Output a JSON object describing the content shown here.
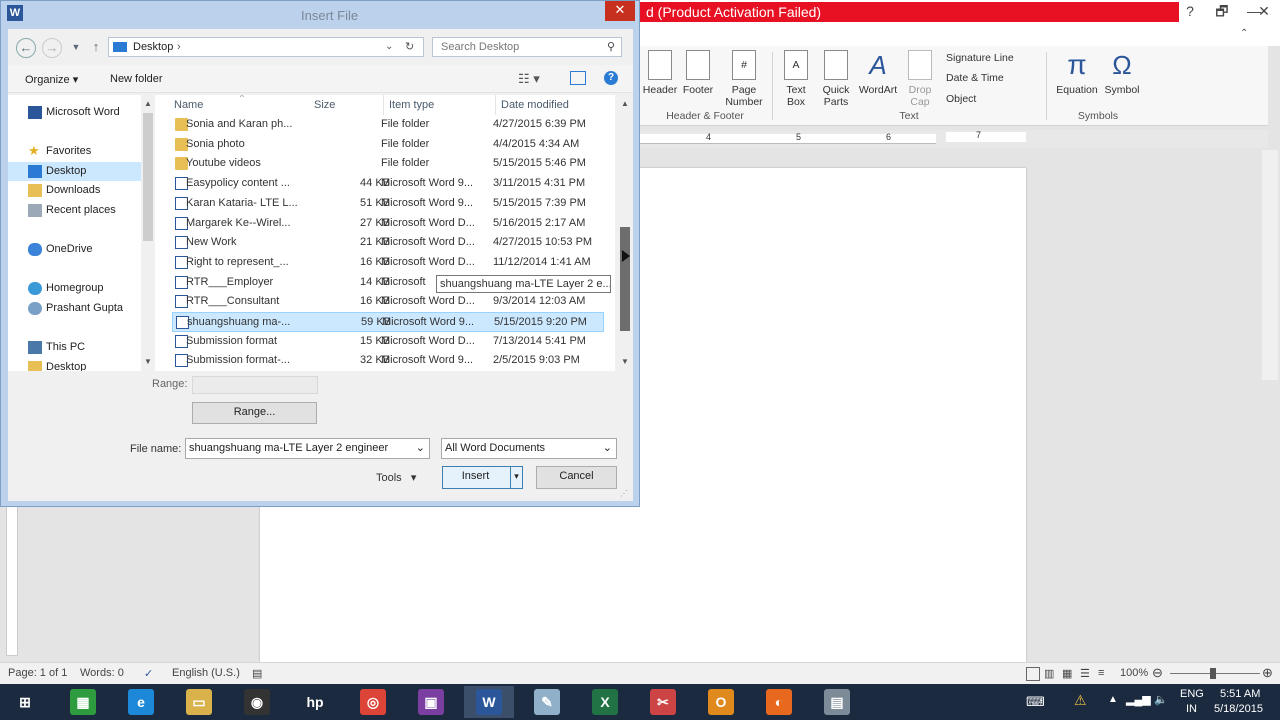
{
  "word": {
    "title_suffix": "d (Product Activation Failed)",
    "window_controls": [
      "?",
      "🗗",
      "—",
      "✕"
    ],
    "ribbon": {
      "buttons": [
        {
          "id": "header",
          "label": "Header"
        },
        {
          "id": "footer",
          "label": "Footer"
        },
        {
          "id": "page_number",
          "label": "Page Number"
        },
        {
          "id": "text_box",
          "label": "Text Box"
        },
        {
          "id": "quick_parts",
          "label": "Quick Parts"
        },
        {
          "id": "wordart",
          "label": "WordArt"
        },
        {
          "id": "drop_cap",
          "label": "Drop Cap"
        },
        {
          "id": "equation",
          "label": "Equation"
        },
        {
          "id": "symbol",
          "label": "Symbol"
        }
      ],
      "small_buttons": [
        "Signature Line",
        "Date & Time",
        "Object"
      ],
      "groups": [
        "Header & Footer",
        "Text",
        "Symbols"
      ],
      "ruler_marks": [
        "4",
        "5",
        "6",
        "7"
      ]
    },
    "status": {
      "page": "Page: 1 of 1",
      "words": "Words: 0",
      "language": "English (U.S.)",
      "zoom": "100%"
    }
  },
  "dialog": {
    "title": "Insert File",
    "close": "✕",
    "address": "Desktop",
    "search_placeholder": "Search Desktop",
    "toolbar": {
      "organize": "Organize",
      "new_folder": "New folder"
    },
    "nav_pane": [
      {
        "label": "Microsoft Word",
        "icon": "word-icon"
      },
      {
        "label": "Favorites",
        "icon": "star-icon"
      },
      {
        "label": "Desktop",
        "icon": "desktop-icon",
        "selected": true
      },
      {
        "label": "Downloads",
        "icon": "downloads-icon"
      },
      {
        "label": "Recent places",
        "icon": "recent-places-icon"
      },
      {
        "label": "OneDrive",
        "icon": "onedrive-icon"
      },
      {
        "label": "Homegroup",
        "icon": "homegroup-icon"
      },
      {
        "label": "Prashant Gupta",
        "icon": "user-icon"
      },
      {
        "label": "This PC",
        "icon": "this-pc-icon"
      },
      {
        "label": "Desktop",
        "icon": "desktop-icon"
      }
    ],
    "columns": [
      "Name",
      "Size",
      "Item type",
      "Date modified"
    ],
    "files": [
      {
        "name": "Sonia and Karan ph...",
        "size": "",
        "type": "File folder",
        "date": "4/27/2015 6:39 PM",
        "kind": "folder"
      },
      {
        "name": "Sonia photo",
        "size": "",
        "type": "File folder",
        "date": "4/4/2015 4:34 AM",
        "kind": "folder"
      },
      {
        "name": "Youtube videos",
        "size": "",
        "type": "File folder",
        "date": "5/15/2015 5:46 PM",
        "kind": "folder"
      },
      {
        "name": "Easypolicy content ...",
        "size": "44 KB",
        "type": "Microsoft Word 9...",
        "date": "3/11/2015 4:31 PM",
        "kind": "doc"
      },
      {
        "name": "Karan Kataria- LTE L...",
        "size": "51 KB",
        "type": "Microsoft Word 9...",
        "date": "5/15/2015 7:39 PM",
        "kind": "doc"
      },
      {
        "name": "Margarek Ke--Wirel...",
        "size": "27 KB",
        "type": "Microsoft Word D...",
        "date": "5/16/2015 2:17 AM",
        "kind": "doc"
      },
      {
        "name": "New Work",
        "size": "21 KB",
        "type": "Microsoft Word D...",
        "date": "4/27/2015 10:53 PM",
        "kind": "doc"
      },
      {
        "name": "Right to represent_...",
        "size": "16 KB",
        "type": "Microsoft Word D...",
        "date": "11/12/2014 1:41 AM",
        "kind": "doc"
      },
      {
        "name": "RTR___Employer",
        "size": "14 KB",
        "type": "Microsoft",
        "date": "",
        "kind": "doc"
      },
      {
        "name": "RTR___Consultant",
        "size": "16 KB",
        "type": "Microsoft Word D...",
        "date": "9/3/2014 12:03 AM",
        "kind": "doc"
      },
      {
        "name": "shuangshuang ma-...",
        "size": "59 KB",
        "type": "Microsoft Word 9...",
        "date": "5/15/2015 9:20 PM",
        "kind": "doc",
        "selected": true
      },
      {
        "name": "Submission format",
        "size": "15 KB",
        "type": "Microsoft Word D...",
        "date": "7/13/2014 5:41 PM",
        "kind": "doc"
      },
      {
        "name": "Submission format-...",
        "size": "32 KB",
        "type": "Microsoft Word 9...",
        "date": "2/5/2015 9:03 PM",
        "kind": "doc"
      }
    ],
    "tooltip": "shuangshuang ma-LTE Layer 2 e...",
    "range_label": "Range:",
    "range_button": "Range...",
    "filename_label": "File name:",
    "filename_value": "shuangshuang ma-LTE Layer 2 engineer",
    "filetype_value": "All Word Documents",
    "tools": "Tools",
    "insert": "Insert",
    "cancel": "Cancel"
  },
  "taskbar": {
    "apps": [
      {
        "name": "windows-start",
        "color": "#1b2a3f",
        "glyph": "⊞"
      },
      {
        "name": "store",
        "color": "#2e9c3e",
        "glyph": "▦"
      },
      {
        "name": "internet-explorer",
        "color": "#1e88d8",
        "glyph": "e"
      },
      {
        "name": "file-explorer",
        "color": "#d9b24c",
        "glyph": "▭"
      },
      {
        "name": "camera",
        "color": "#333333",
        "glyph": "◉"
      },
      {
        "name": "hp",
        "color": "#1b2a3f",
        "glyph": "hp"
      },
      {
        "name": "chrome",
        "color": "#db4437",
        "glyph": "◎"
      },
      {
        "name": "media",
        "color": "#7a3fa0",
        "glyph": "▣"
      },
      {
        "name": "word",
        "color": "#2b579a",
        "glyph": "W",
        "active": true
      },
      {
        "name": "notepad",
        "color": "#8fb0c8",
        "glyph": "✎"
      },
      {
        "name": "excel",
        "color": "#217346",
        "glyph": "X"
      },
      {
        "name": "snipping-tool",
        "color": "#c44",
        "glyph": "✂"
      },
      {
        "name": "outlook",
        "color": "#e08a1e",
        "glyph": "O"
      },
      {
        "name": "firefox",
        "color": "#e8681d",
        "glyph": "◐"
      },
      {
        "name": "calculator",
        "color": "#7d8b99",
        "glyph": "▤"
      }
    ],
    "language": "ENG",
    "region": "IN",
    "time": "5:51 AM",
    "date": "5/18/2015"
  }
}
